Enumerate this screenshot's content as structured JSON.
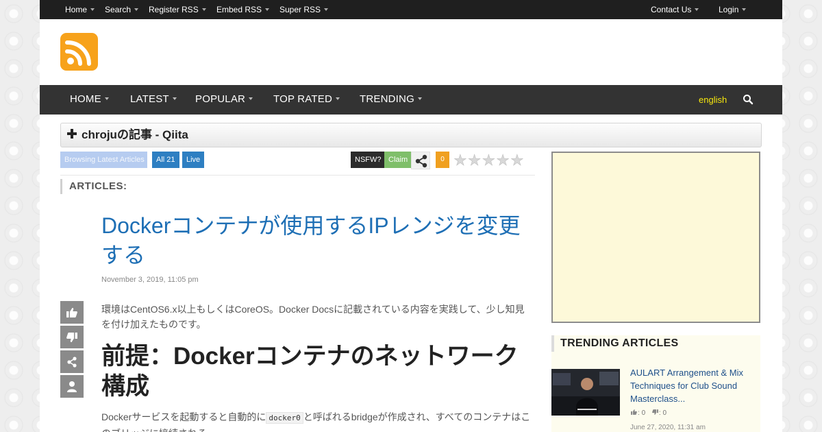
{
  "topnav": {
    "items": [
      "Home",
      "Search",
      "Register RSS",
      "Embed RSS",
      "Super RSS"
    ],
    "right": [
      "Contact Us",
      "Login"
    ]
  },
  "mainnav": {
    "items": [
      "HOME",
      "LATEST",
      "POPULAR",
      "TOP RATED",
      "TRENDING"
    ],
    "language": "english"
  },
  "feed": {
    "title": "chrojuの記事 - Qiita"
  },
  "badges": {
    "browse": "Browsing Latest Articles",
    "all": "All 21",
    "live": "Live",
    "nsfw": "NSFW?",
    "claim": "Claim",
    "rating_count": "0",
    "stars": [
      "★",
      "★",
      "★",
      "★",
      "★"
    ]
  },
  "articles_label": "ARTICLES:",
  "article": {
    "title": "Dockerコンテナが使用するIPレンジを変更する",
    "date": "November 3, 2019, 11:05 pm",
    "intro": "環境はCentOS6.x以上もしくはCoreOS。Docker Docsに記載されている内容を実践して、少し知見を付け加えたものです。",
    "heading": "前提：Dockerコンテナのネットワーク構成",
    "body_before_code": "Dockerサービスを起動すると自動的に",
    "body_code": "docker0",
    "body_after_code": "と呼ばれるbridgeが作成され、すべてのコンテナはこのブリッジに接続される。"
  },
  "trending": {
    "heading": "TRENDING ARTICLES",
    "items": [
      {
        "title": "AULART Arrangement & Mix Techniques for Club Sound Masterclass...",
        "likes": "0",
        "dislikes": "0",
        "date": "June 27, 2020, 11:31 am"
      }
    ]
  },
  "colors": {
    "logo": "#f7a21b",
    "link": "#1e6fb5",
    "language": "#f7e70d",
    "badge_blue": "#2e7fc2",
    "badge_orange": "#f0a020",
    "badge_green": "#7fbf6a"
  }
}
